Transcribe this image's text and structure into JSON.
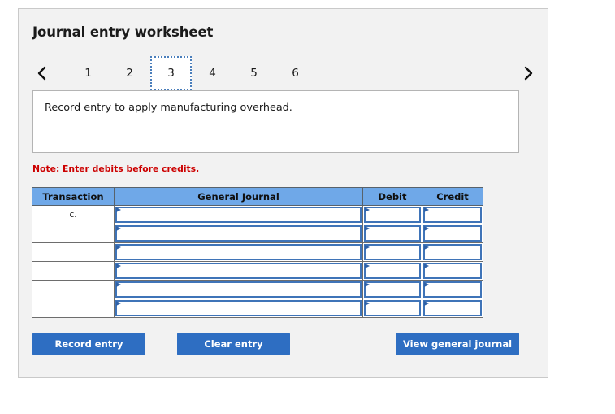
{
  "worksheet": {
    "title": "Journal entry worksheet",
    "nav": {
      "prev_icon": "chevron-left-icon",
      "next_icon": "chevron-right-icon"
    },
    "tabs": [
      {
        "label": "1",
        "selected": false
      },
      {
        "label": "2",
        "selected": false
      },
      {
        "label": "3",
        "selected": true
      },
      {
        "label": "4",
        "selected": false
      },
      {
        "label": "5",
        "selected": false
      },
      {
        "label": "6",
        "selected": false
      }
    ],
    "instruction": "Record entry to apply manufacturing overhead.",
    "note": "Note: Enter debits before credits.",
    "table": {
      "headers": [
        "Transaction",
        "General Journal",
        "Debit",
        "Credit"
      ],
      "rows": [
        {
          "transaction": "c.",
          "general_journal": "",
          "debit": "",
          "credit": ""
        },
        {
          "transaction": "",
          "general_journal": "",
          "debit": "",
          "credit": ""
        },
        {
          "transaction": "",
          "general_journal": "",
          "debit": "",
          "credit": ""
        },
        {
          "transaction": "",
          "general_journal": "",
          "debit": "",
          "credit": ""
        },
        {
          "transaction": "",
          "general_journal": "",
          "debit": "",
          "credit": ""
        },
        {
          "transaction": "",
          "general_journal": "",
          "debit": "",
          "credit": ""
        }
      ]
    },
    "buttons": {
      "record": "Record entry",
      "clear": "Clear entry",
      "view": "View general journal"
    },
    "colors": {
      "header_blue": "#6fa8e8",
      "button_blue": "#2e6ec2",
      "note_red": "#cc0000",
      "input_border": "#3f74b8",
      "panel_bg": "#f2f2f2"
    }
  }
}
